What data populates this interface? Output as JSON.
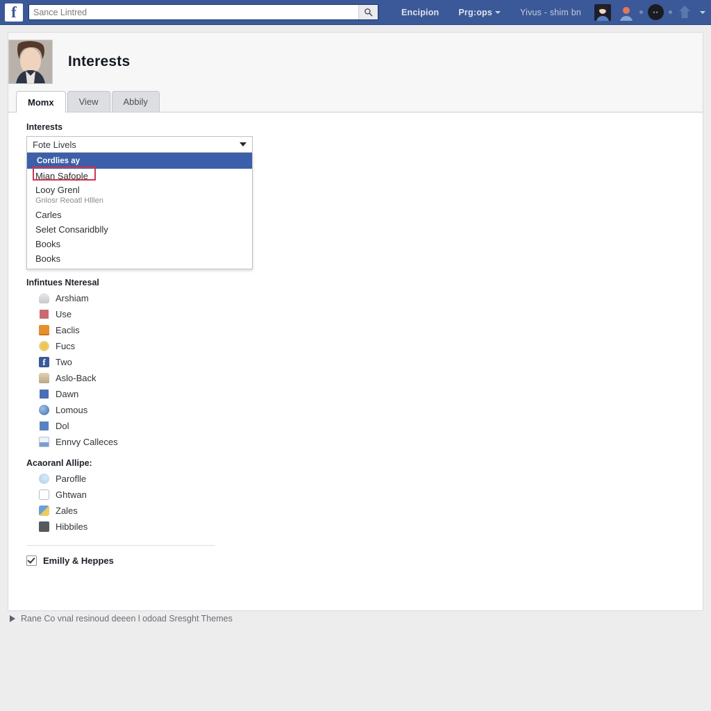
{
  "topbar": {
    "logo_letter": "f",
    "search": {
      "value": "Sance Lintred",
      "placeholder": "Search",
      "icon": "search-icon"
    },
    "links": [
      {
        "label": "Encipion",
        "has_caret": false
      },
      {
        "label": "Prg:ops",
        "has_caret": true
      },
      {
        "label": "Yivus - shim bn",
        "has_caret": false
      }
    ],
    "badge_text": "••",
    "colors": {
      "bar": "#3b5998",
      "bar_border": "#29487d",
      "link": "#dfe3ee"
    }
  },
  "profile": {
    "title": "Interests",
    "avatar": "profile-photo"
  },
  "tabs": [
    {
      "label": "Momx",
      "active": true
    },
    {
      "label": "View",
      "active": false
    },
    {
      "label": "Abbily",
      "active": false
    }
  ],
  "form": {
    "select_label": "Interests",
    "select_value": "Fote Livels",
    "options": [
      {
        "label": "Cordlies ay",
        "selected": true,
        "sub": null
      },
      {
        "label": "Mian Safople",
        "selected": false,
        "sub": null
      },
      {
        "label": "Looy Grenl",
        "selected": false,
        "sub": "Gnlosr Reoatl Hlllen"
      },
      {
        "label": "Carles",
        "selected": false,
        "sub": null
      },
      {
        "label": "Selet Consaridblly",
        "selected": false,
        "sub": null
      },
      {
        "label": "Books",
        "selected": false,
        "sub": null
      },
      {
        "label": "Books",
        "selected": false,
        "sub": null
      }
    ],
    "annotation_color": "#d1344e",
    "highlight_color": "#3b5fa8"
  },
  "sections": [
    {
      "heading": "Infintues Nteresal",
      "items": [
        {
          "label": "Arshiam",
          "icon": "lamp-icon"
        },
        {
          "label": "Use",
          "icon": "film-icon"
        },
        {
          "label": "Eaclis",
          "icon": "box-icon"
        },
        {
          "label": "Fucs",
          "icon": "star-icon"
        },
        {
          "label": "Two",
          "icon": "facebook-icon"
        },
        {
          "label": "Aslo-Back",
          "icon": "bag-icon"
        },
        {
          "label": "Dawn",
          "icon": "picture-icon"
        },
        {
          "label": "Lomous",
          "icon": "globe-icon"
        },
        {
          "label": "Dol",
          "icon": "quill-icon"
        },
        {
          "label": "Ennvy Calleces",
          "icon": "chart-icon"
        }
      ]
    },
    {
      "heading": "Acaoranl Allipe:",
      "items": [
        {
          "label": "Paroflle",
          "icon": "swirl-icon"
        },
        {
          "label": "Ghtwan",
          "icon": "outline-box-icon"
        },
        {
          "label": "Zales",
          "icon": "people-icon"
        },
        {
          "label": "Hibbiles",
          "icon": "gray-square-icon"
        }
      ]
    }
  ],
  "checkbox": {
    "label": "Emilly & Heppes",
    "checked": true
  },
  "footer": {
    "text": "Rane Co vnal resinoud deeen l odoad Sresght Themes"
  }
}
